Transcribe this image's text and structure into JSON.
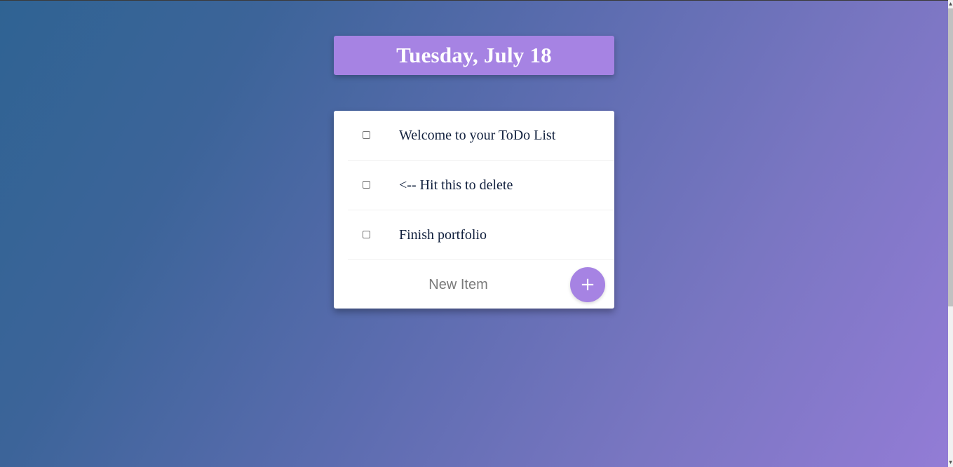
{
  "header": {
    "date_title": "Tuesday, July 18"
  },
  "todo": {
    "items": [
      {
        "label": "Welcome to your ToDo List",
        "checked": false
      },
      {
        "label": "<-- Hit this to delete",
        "checked": false
      },
      {
        "label": "Finish portfolio",
        "checked": false
      }
    ],
    "new_item": {
      "placeholder": "New Item",
      "value": ""
    },
    "add_button_label": "+"
  },
  "icons": {
    "scroll_up": "scroll-up-arrow-icon",
    "scroll_down": "scroll-down-arrow-icon"
  },
  "colors": {
    "accent": "#a683e3",
    "text": "#12213e",
    "background_start": "#2f6393",
    "background_end": "#937cd6"
  }
}
